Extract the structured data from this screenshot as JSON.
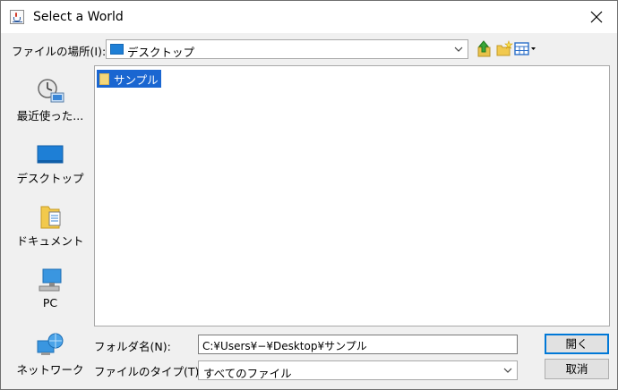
{
  "window": {
    "title": "Select a World"
  },
  "lookin": {
    "label": "ファイルの場所(I):",
    "value": "デスクトップ"
  },
  "places": [
    {
      "label": "最近使った..."
    },
    {
      "label": "デスクトップ"
    },
    {
      "label": "ドキュメント"
    },
    {
      "label": "PC"
    },
    {
      "label": "ネットワーク"
    }
  ],
  "files": [
    {
      "name": "サンプル",
      "selected": true
    }
  ],
  "filename": {
    "label": "フォルダ名(N):",
    "value": "C:¥Users¥−¥Desktop¥サンプル"
  },
  "filetype": {
    "label": "ファイルのタイプ(T):",
    "value": "すべてのファイル"
  },
  "buttons": {
    "open": "開く",
    "cancel": "取消"
  },
  "colors": {
    "selection": "#1a66d1",
    "accent": "#0078d7"
  },
  "icons": [
    "java-app-icon",
    "close-icon",
    "folder-icon",
    "chevron-down-icon",
    "up-folder-icon",
    "new-folder-icon",
    "view-menu-icon",
    "recent-icon",
    "desktop-icon",
    "documents-icon",
    "pc-icon",
    "network-icon"
  ]
}
